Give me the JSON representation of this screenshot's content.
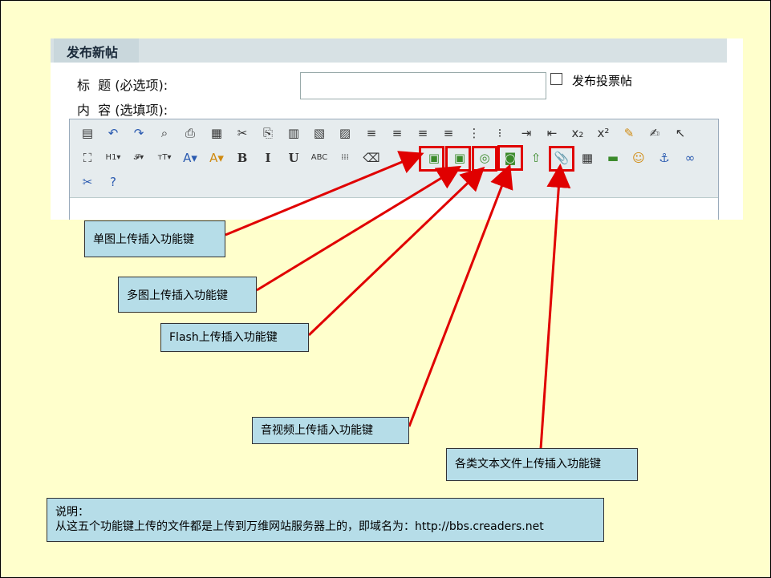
{
  "form": {
    "section_title": "发布新帖",
    "title_label": "标  题 (必选项):",
    "content_label": "内  容 (选填项):",
    "vote_label": "发布投票帖"
  },
  "toolbar": {
    "row1_icons": [
      "paste-word-icon",
      "undo-icon",
      "redo-icon",
      "preview-icon",
      "print-icon",
      "template-icon",
      "cut-icon",
      "copy-icon",
      "paste-icon",
      "paste-text-icon",
      "paste-from-word-icon",
      "align-left-icon",
      "align-center-icon",
      "align-right-icon",
      "justify-icon",
      "ordered-list-icon",
      "bullet-list-icon",
      "indent-icon",
      "outdent-icon",
      "subscript-icon",
      "superscript-icon",
      "remove-format-icon",
      "replace-icon",
      "select-all-icon"
    ],
    "row1_glyphs": [
      "▤",
      "↶",
      "↷",
      "⌕",
      "⎙",
      "▦",
      "✂",
      "⎘",
      "▥",
      "▧",
      "▨",
      "≡",
      "≡",
      "≡",
      "≡",
      "⋮",
      "⁝",
      "⇥",
      "⇤",
      "x₂",
      "x²",
      "✎",
      "✍",
      "↖"
    ],
    "row2_icons": [
      "maximize-icon",
      "heading-icon",
      "font-family-icon",
      "font-size-icon",
      "text-color-icon",
      "bg-color-icon",
      "bold-icon",
      "italic-icon",
      "underline-icon",
      "strikethrough-icon",
      "table-layout-icon",
      "eraser-icon",
      "single-image-upload-icon",
      "multi-image-upload-icon",
      "flash-upload-icon",
      "media-upload-icon",
      "upload-icon",
      "attachment-upload-icon",
      "table-icon",
      "hr-icon",
      "emoticon-icon",
      "anchor-icon",
      "link-icon"
    ],
    "row2_glyphs": [
      "⛶",
      "H1▾",
      "𝓕▾",
      "тT▾",
      "A▾",
      "A▾",
      "B",
      "I",
      "U",
      "ABC",
      "⁞⁞⁞",
      "⌫",
      "▣",
      "▣",
      "◎",
      "◙",
      "⇧",
      "📎",
      "▦",
      "▬",
      "☺",
      "⚓",
      "∞"
    ],
    "row3_icons": [
      "unlink-icon",
      "help-icon"
    ],
    "row3_glyphs": [
      "✂",
      "?"
    ]
  },
  "notes": {
    "single_image": "单图上传插入功能键",
    "multi_image": "多图上传插入功能键",
    "flash": "Flash上传插入功能键",
    "media": "音视频上传插入功能键",
    "file": "各类文本文件上传插入功能键"
  },
  "explanation": {
    "line1": "说明：",
    "line2": "从这五个功能键上传的文件都是上传到万维网站服务器上的，即域名为：http://bbs.creaders.net"
  },
  "colors": {
    "page_background": "#ffffcc",
    "callout_background": "#b6dde8",
    "highlight": "#e00000"
  }
}
